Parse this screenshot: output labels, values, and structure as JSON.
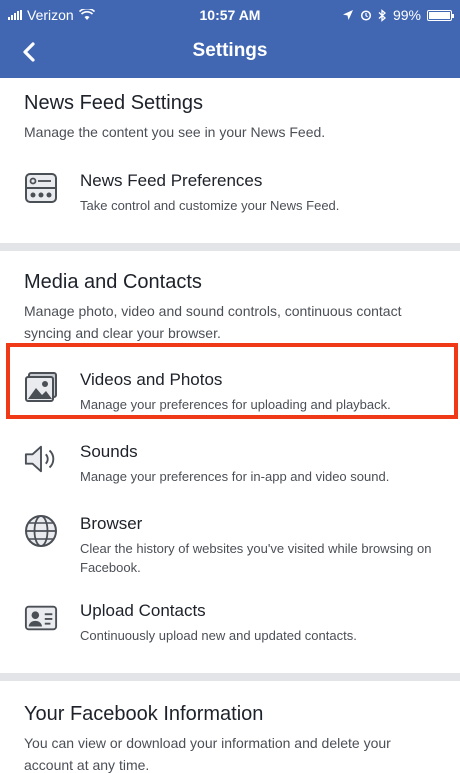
{
  "status_bar": {
    "carrier": "Verizon",
    "time": "10:57 AM",
    "battery": "99%",
    "battery_level": 0.99,
    "icons": [
      "signal-icon",
      "wifi-icon",
      "location-icon",
      "alarm-icon",
      "bluetooth-icon",
      "battery-icon"
    ]
  },
  "header": {
    "title": "Settings",
    "back_icon": "back-arrow-icon",
    "background": "#4267b2"
  },
  "sections": {
    "news_feed": {
      "title": "News Feed Settings",
      "subtitle": "Manage the content you see in your News Feed.",
      "items": [
        {
          "title": "News Feed Preferences",
          "description": "Take control and customize your News Feed.",
          "icon": "news-feed-preferences-icon"
        }
      ]
    },
    "media": {
      "title": "Media and Contacts",
      "subtitle": "Manage photo, video and sound controls, continuous contact syncing and clear your browser.",
      "items": [
        {
          "title": "Videos and Photos",
          "description": "Manage your preferences for uploading and playback.",
          "icon": "photo-icon",
          "highlighted": true
        },
        {
          "title": "Sounds",
          "description": "Manage your preferences for in-app and video sound.",
          "icon": "speaker-icon"
        },
        {
          "title": "Browser",
          "description": "Clear the history of websites you've visited while browsing on Facebook.",
          "icon": "globe-icon"
        },
        {
          "title": "Upload Contacts",
          "description": "Continuously upload new and updated contacts.",
          "icon": "contact-card-icon"
        }
      ]
    },
    "your_info": {
      "title": "Your Facebook Information",
      "subtitle": "You can view or download your information and delete your account at any time."
    }
  },
  "colors": {
    "brand": "#4267b2",
    "highlight": "#f03a17",
    "divider": "#e3e4e8"
  }
}
